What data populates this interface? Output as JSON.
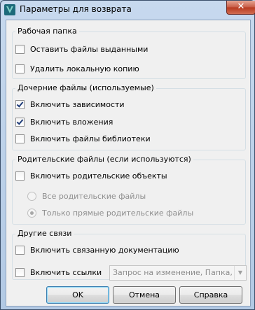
{
  "window": {
    "title": "Параметры для возврата",
    "close_glyph": "✕"
  },
  "groups": {
    "working_folder": {
      "title": "Рабочая папка",
      "keep_checked_out": {
        "label": "Оставить файлы выданными",
        "checked": false
      },
      "delete_local_copy": {
        "label": "Удалить локальную копию",
        "checked": false
      }
    },
    "children": {
      "title": "Дочерние файлы (используемые)",
      "include_dependencies": {
        "label": "Включить зависимости",
        "checked": true
      },
      "include_attachments": {
        "label": "Включить вложения",
        "checked": true
      },
      "include_library_files": {
        "label": "Включить файлы библиотеки",
        "checked": false
      }
    },
    "parents": {
      "title": "Родительские файлы (если используются)",
      "include_parents": {
        "label": "Включить родительские объекты",
        "checked": false
      },
      "all_parents": {
        "label": "Все родительские файлы",
        "selected": false,
        "enabled": false
      },
      "direct_parents": {
        "label": "Только прямые родительские файлы",
        "selected": true,
        "enabled": false
      }
    },
    "other_links": {
      "title": "Другие связи",
      "include_linked_docs": {
        "label": "Включить связанную документацию",
        "checked": false
      },
      "include_links": {
        "label": "Включить ссылки",
        "checked": false
      },
      "links_combo": {
        "value": "Запрос на изменение, Папка, ...",
        "enabled": false
      }
    }
  },
  "buttons": {
    "ok": "OK",
    "cancel": "Отмена",
    "help": "Справка"
  },
  "colors": {
    "title_bar": "#bcd1e8",
    "dialog_bg": "#f0f0f0",
    "close_button": "#c75a44"
  }
}
